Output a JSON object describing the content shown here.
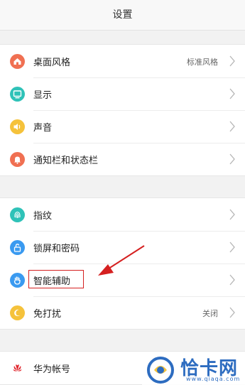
{
  "header": {
    "title": "设置"
  },
  "groups": [
    {
      "items": [
        {
          "label": "桌面风格",
          "value": "标准风格",
          "icon": "home-icon",
          "color": "#f07052"
        },
        {
          "label": "显示",
          "value": "",
          "icon": "display-icon",
          "color": "#2fc2b8"
        },
        {
          "label": "声音",
          "value": "",
          "icon": "speaker-icon",
          "color": "#f5c23b"
        },
        {
          "label": "通知栏和状态栏",
          "value": "",
          "icon": "bell-icon",
          "color": "#f07052"
        }
      ]
    },
    {
      "items": [
        {
          "label": "指纹",
          "value": "",
          "icon": "fingerprint-icon",
          "color": "#2fc2b8"
        },
        {
          "label": "锁屏和密码",
          "value": "",
          "icon": "lock-icon",
          "color": "#3a9af0"
        },
        {
          "label": "智能辅助",
          "value": "",
          "icon": "hand-icon",
          "color": "#3a9af0"
        },
        {
          "label": "免打扰",
          "value": "关闭",
          "icon": "moon-icon",
          "color": "#f5c23b"
        }
      ]
    },
    {
      "items": [
        {
          "label": "华为帐号",
          "value": "",
          "icon": "huawei-logo-icon",
          "color": "#e0262d"
        }
      ]
    }
  ],
  "watermark": {
    "text": "恰卡网",
    "sub": "www.qiaqa.com"
  }
}
